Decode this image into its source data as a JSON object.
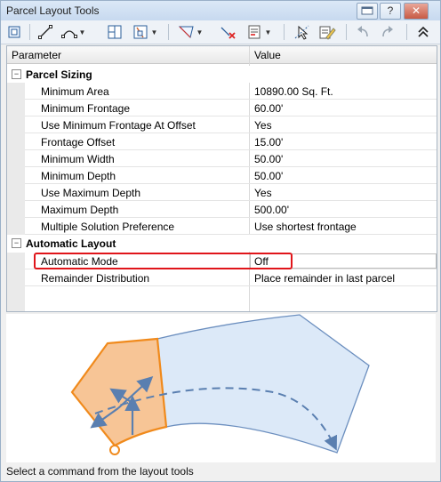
{
  "window": {
    "title": "Parcel Layout Tools"
  },
  "titlebar_buttons": {
    "help": "?",
    "close": "✕"
  },
  "toolbar": {
    "icons": [
      "parcel-layout-icon",
      "draw-line-icon",
      "curve-dropdown-icon",
      "slide-line-icon",
      "swing-line-icon",
      "create-segment-icon",
      "delete-sub-entity-icon",
      "pi-dropdown-icon",
      "select-parcel-icon",
      "edit-parcel-icon",
      "undo-icon",
      "redo-icon",
      "collapse-icon"
    ]
  },
  "grid": {
    "headers": {
      "parameter": "Parameter",
      "value": "Value"
    },
    "categories": [
      {
        "label": "Parcel Sizing",
        "toggle": "−",
        "rows": [
          {
            "name": "Minimum Area",
            "value": "10890.00 Sq. Ft."
          },
          {
            "name": "Minimum Frontage",
            "value": "60.00'"
          },
          {
            "name": "Use Minimum Frontage At Offset",
            "value": "Yes"
          },
          {
            "name": "Frontage Offset",
            "value": "15.00'"
          },
          {
            "name": "Minimum Width",
            "value": "50.00'"
          },
          {
            "name": "Minimum Depth",
            "value": "50.00'"
          },
          {
            "name": "Use Maximum Depth",
            "value": "Yes"
          },
          {
            "name": "Maximum Depth",
            "value": "500.00'"
          },
          {
            "name": "Multiple Solution Preference",
            "value": "Use shortest frontage"
          }
        ]
      },
      {
        "label": "Automatic Layout",
        "toggle": "−",
        "rows": [
          {
            "name": "Automatic Mode",
            "value": "Off"
          },
          {
            "name": "Remainder Distribution",
            "value": "Place remainder in last parcel"
          }
        ]
      }
    ]
  },
  "colors": {
    "highlight": "#e0151a",
    "parcel_orange": "#f59b3c",
    "parcel_blue": "#dce9f8"
  },
  "status": {
    "text": "Select a command from the layout tools"
  }
}
